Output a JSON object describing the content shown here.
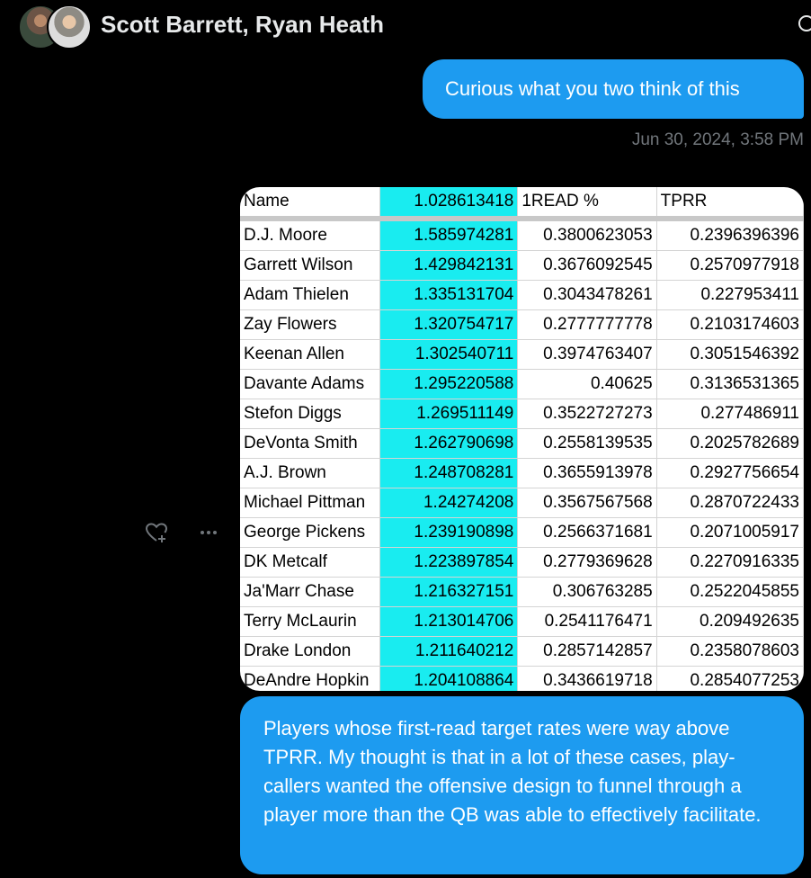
{
  "header": {
    "title": "Scott Barrett, Ryan Heath"
  },
  "messages": {
    "first": {
      "text": "Curious what you two think of this",
      "timestamp": "Jun 30, 2024, 3:58 PM"
    },
    "second": {
      "text": "Players whose first-read target rates were way above TPRR. My thought is that in a lot of these cases, play-callers wanted the offensive design to funnel through a player more than the QB was able to effectively facilitate."
    }
  },
  "table": {
    "headers": [
      "Name",
      "1.028613418",
      "1READ %",
      "TPRR"
    ],
    "rows": [
      [
        "D.J. Moore",
        "1.585974281",
        "0.3800623053",
        "0.2396396396"
      ],
      [
        "Garrett Wilson",
        "1.429842131",
        "0.3676092545",
        "0.2570977918"
      ],
      [
        "Adam Thielen",
        "1.335131704",
        "0.3043478261",
        "0.227953411"
      ],
      [
        "Zay Flowers",
        "1.320754717",
        "0.2777777778",
        "0.2103174603"
      ],
      [
        "Keenan Allen",
        "1.302540711",
        "0.3974763407",
        "0.3051546392"
      ],
      [
        "Davante Adams",
        "1.295220588",
        "0.40625",
        "0.3136531365"
      ],
      [
        "Stefon Diggs",
        "1.269511149",
        "0.3522727273",
        "0.277486911"
      ],
      [
        "DeVonta Smith",
        "1.262790698",
        "0.2558139535",
        "0.2025782689"
      ],
      [
        "A.J. Brown",
        "1.248708281",
        "0.3655913978",
        "0.2927756654"
      ],
      [
        "Michael Pittman",
        "1.24274208",
        "0.3567567568",
        "0.2870722433"
      ],
      [
        "George Pickens",
        "1.239190898",
        "0.2566371681",
        "0.2071005917"
      ],
      [
        "DK Metcalf",
        "1.223897854",
        "0.2779369628",
        "0.2270916335"
      ],
      [
        "Ja'Marr Chase",
        "1.216327151",
        "0.306763285",
        "0.2522045855"
      ],
      [
        "Terry McLaurin",
        "1.213014706",
        "0.2541176471",
        "0.209492635"
      ],
      [
        "Drake London",
        "1.211640212",
        "0.2857142857",
        "0.2358078603"
      ],
      [
        "DeAndre Hopkin",
        "1.204108864",
        "0.3436619718",
        "0.2854077253"
      ]
    ]
  },
  "icons": {
    "react": "heart-plus-icon",
    "more": "more-dots-icon",
    "info": "info-icon"
  },
  "colors": {
    "accent": "#1d9bf0",
    "highlight": "#19ecf0",
    "muted": "#71767b"
  }
}
